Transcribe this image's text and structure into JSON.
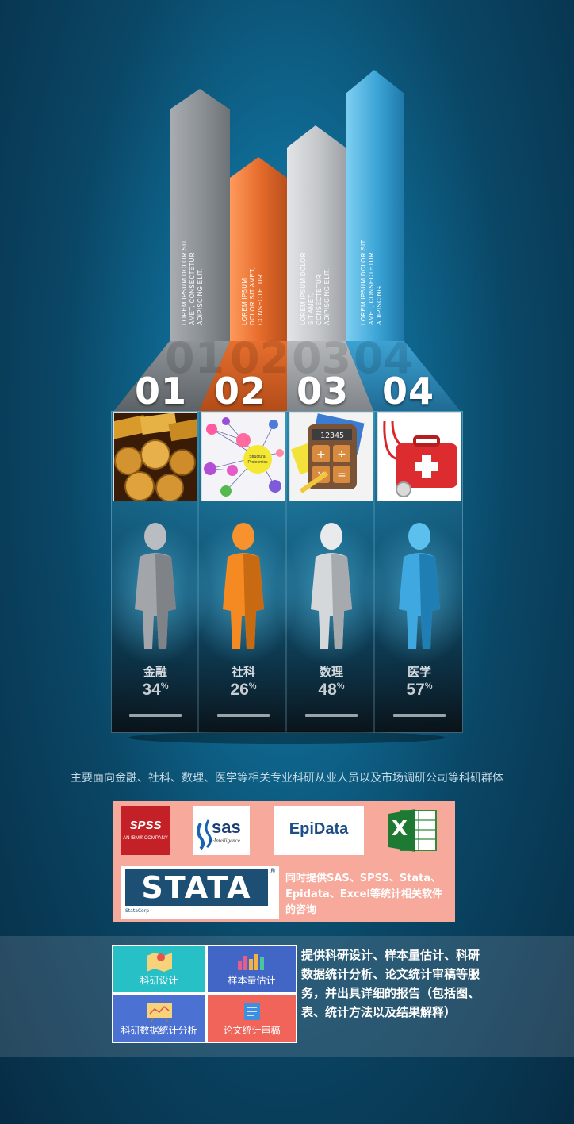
{
  "columns": [
    {
      "num": "01",
      "arrow_text": "LOREM IPSUM DOLOR SIT AMET, CONSECTETUR ADIPISCING ELIT.",
      "label": "金融",
      "percent": "34",
      "color": "#9aa0a6"
    },
    {
      "num": "02",
      "arrow_text": "LOREM IPSUM DOLOR SIT AMET, CONSECTETUR",
      "label": "社科",
      "percent": "26",
      "color": "#e8773a"
    },
    {
      "num": "03",
      "arrow_text": "LOREM IPSUM DOLOR SIT AMET, CONSECTETUR ADIPISCING ELIT.",
      "label": "数理",
      "percent": "48",
      "color": "#c9cdd1"
    },
    {
      "num": "04",
      "arrow_text": "LOREM IPSUM DOLOR SIT AMET, CONSECTETUR ADIPISCING",
      "label": "医学",
      "percent": "57",
      "color": "#3ea6d8"
    }
  ],
  "percent_sign": "%",
  "column_images": [
    "gold-coins",
    "proteomics-network",
    "calculator",
    "first-aid-kit"
  ],
  "network_labels": [
    "Structural",
    "Proteomics"
  ],
  "calculator_display": "12345",
  "caption": "主要面向金融、社科、数理、医学等相关专业科研从业人员以及市场调研公司等科研群体",
  "software": {
    "spss": "SPSS",
    "spss_sub": "AN IBM® COMPANY",
    "sas": "sas",
    "sas_sub": "e·Intelligence",
    "epidata": "EpiData",
    "excel": "X",
    "stata": "STATA",
    "stata_mark": "®",
    "stata_sub": "StataCorp",
    "note": "同时提供SAS、SPSS、Stata、Epidata、Excel等统计相关软件的咨询",
    "bg_color": "#f7a99b"
  },
  "services": {
    "tiles": [
      {
        "label": "科研设计",
        "color": "#27c0c7"
      },
      {
        "label": "样本量估计",
        "color": "#4266c6"
      },
      {
        "label": "科研数据统计分析",
        "color": "#4b72d2"
      },
      {
        "label": "论文统计审稿",
        "color": "#f0645a"
      }
    ],
    "description": "提供科研设计、样本量估计、科研数据统计分析、论文统计审稿等服务，并出具详细的报告（包括图、表、统计方法以及结果解释）"
  }
}
